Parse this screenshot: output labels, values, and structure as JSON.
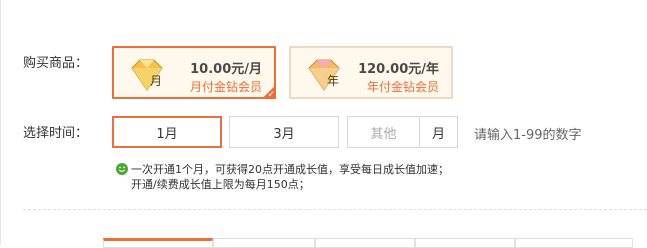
{
  "labels": {
    "products": "购买商品：",
    "duration": "选择时间："
  },
  "products": [
    {
      "icon_char": "月",
      "price": "10.00元/月",
      "name": "月付金钻会员",
      "selected": true
    },
    {
      "icon_char": "年",
      "price": "120.00元/年",
      "name": "年付金钻会员",
      "selected": false
    }
  ],
  "duration": {
    "options": [
      "1月",
      "3月"
    ],
    "other_placeholder": "其他",
    "unit": "月",
    "hint": "请输入1-99的数字"
  },
  "info": {
    "line1": "一次开通1个月，可获得20点开通成长值，享受每日成长值加速；",
    "line2": "开通/续费成长值上限为每月150点；"
  },
  "colors": {
    "accent": "#ec6f3a",
    "card_bg": "#fff8ec",
    "smile": "#4aaa2e"
  },
  "icons": {
    "gem": "diamond-icon",
    "selected": "checkmark-icon",
    "info": "smile-icon"
  }
}
